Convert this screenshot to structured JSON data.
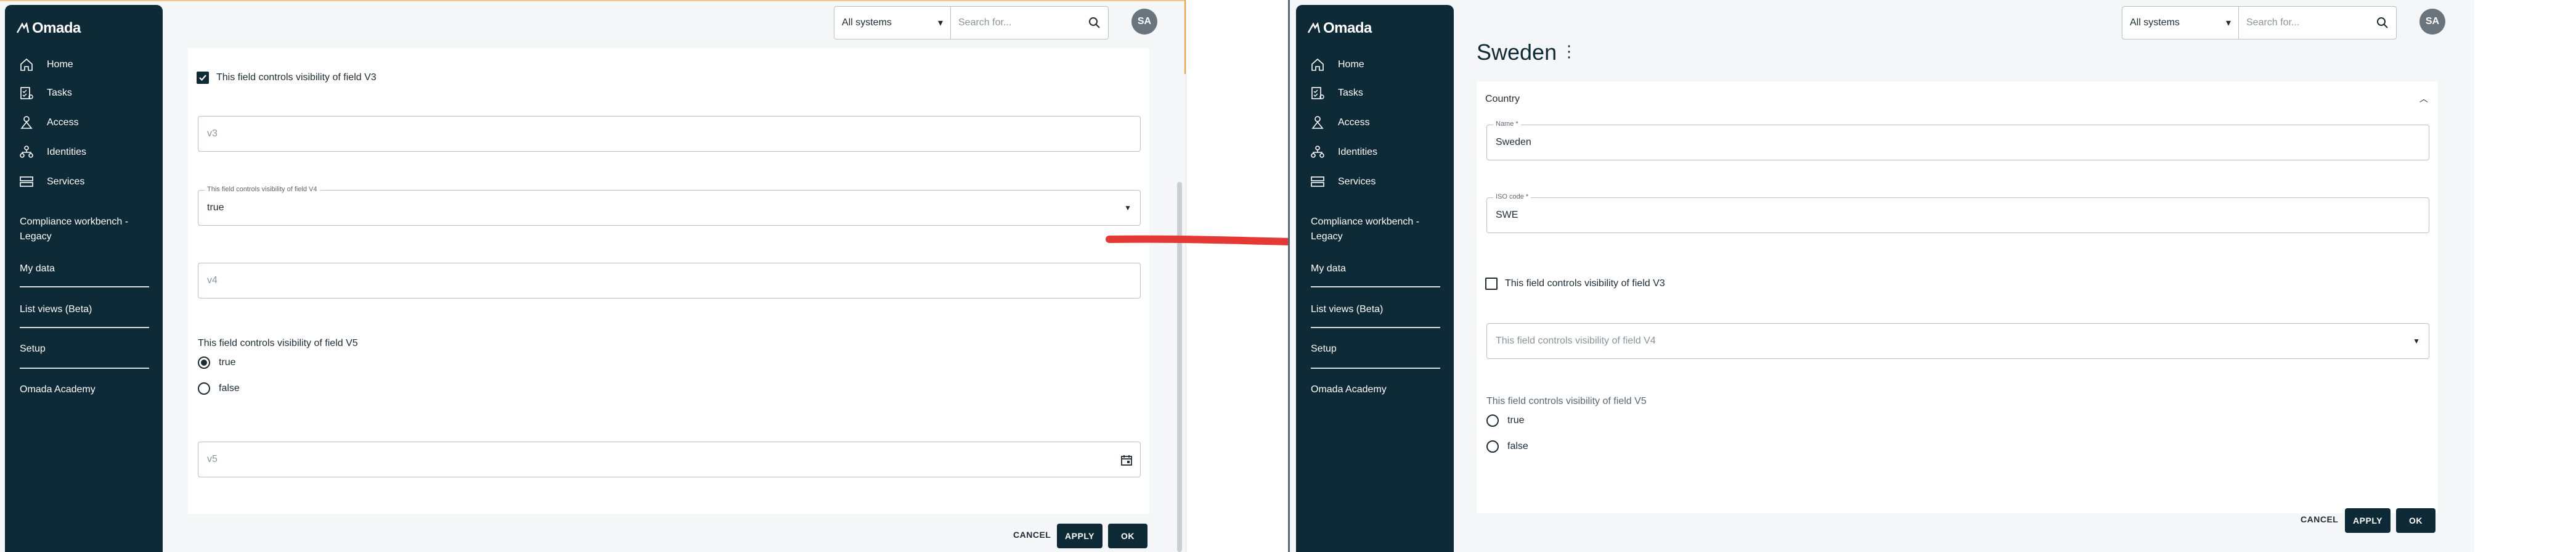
{
  "left": {
    "logo": "Omada",
    "nav": {
      "home": "Home",
      "tasks": "Tasks",
      "access": "Access",
      "identities": "Identities",
      "services": "Services",
      "compliance": "Compliance workbench - Legacy",
      "my_data": "My data",
      "list_views": "List views (Beta)",
      "setup": "Setup",
      "academy": "Omada Academy"
    },
    "topbar": {
      "systems_value": "All systems",
      "search_placeholder": "Search for...",
      "avatar": "SA"
    },
    "form": {
      "v3_checkbox_label": "This field controls visibility of field V3",
      "v3_checked": true,
      "v3_placeholder": "v3",
      "v4_select_label": "This field controls visibility of field V4",
      "v4_select_value": "true",
      "v4_placeholder": "v4",
      "v5_radio_label": "This field controls visibility of field V5",
      "radio_options": [
        "true",
        "false"
      ],
      "radio_selected": "true",
      "v5_placeholder": "v5"
    },
    "actions": {
      "cancel": "CANCEL",
      "apply": "APPLY",
      "ok": "OK"
    }
  },
  "right": {
    "logo": "Omada",
    "nav": {
      "home": "Home",
      "tasks": "Tasks",
      "access": "Access",
      "identities": "Identities",
      "services": "Services",
      "compliance": "Compliance workbench - Legacy",
      "my_data": "My data",
      "list_views": "List views (Beta)",
      "setup": "Setup",
      "academy": "Omada Academy"
    },
    "topbar": {
      "systems_value": "All systems",
      "search_placeholder": "Search for...",
      "avatar": "SA"
    },
    "page_title": "Sweden",
    "section": "Country",
    "form": {
      "name_label": "Name *",
      "name_value": "Sweden",
      "iso_label": "ISO code *",
      "iso_value": "SWE",
      "v3_checkbox_label": "This field controls visibility of field V3",
      "v3_checked": false,
      "v4_select_placeholder": "This field controls visibility of field V4",
      "v5_radio_label": "This field controls visibility of field V5",
      "radio_options": [
        "true",
        "false"
      ]
    },
    "actions": {
      "cancel": "CANCEL",
      "apply": "APPLY",
      "ok": "OK"
    }
  },
  "colors": {
    "sidebar_bg": "#0d2a36",
    "arrow": "#e53935",
    "primary_button": "#0d2a36",
    "page_bg": "#f4f6f8"
  }
}
